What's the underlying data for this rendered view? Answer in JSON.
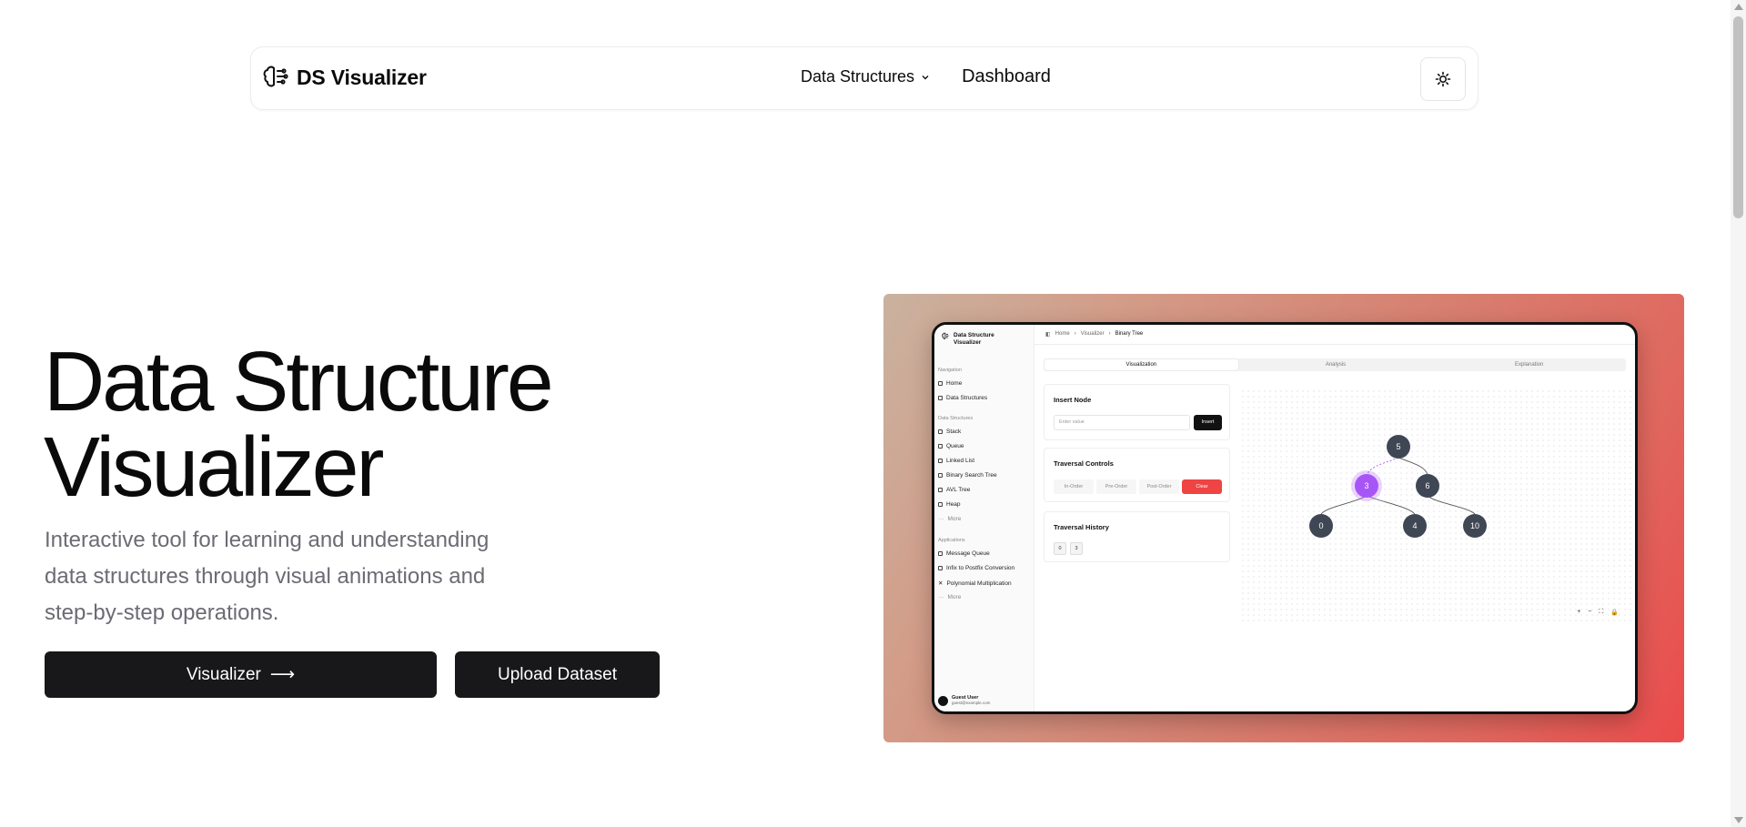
{
  "navbar": {
    "brand": "DS Visualizer",
    "nav_dropdown": "Data Structures",
    "nav_link": "Dashboard"
  },
  "hero": {
    "title_line1": "Data Structure",
    "title_line2": "Visualizer",
    "subtitle": "Interactive tool for learning and understanding data structures through visual animations and step-by-step operations.",
    "primary_button": "Visualizer",
    "primary_arrow": "⟶",
    "secondary_button": "Upload Dataset"
  },
  "preview": {
    "app_title": "Data Structure Visualizer",
    "sidebar": {
      "nav_section": "Navigation",
      "nav_items": [
        "Home",
        "Data Structures"
      ],
      "ds_section": "Data Structures",
      "ds_items": [
        "Stack",
        "Queue",
        "Linked List",
        "Binary Search Tree",
        "AVL Tree",
        "Heap",
        "More"
      ],
      "apps_section": "Applications",
      "apps_items": [
        "Message Queue",
        "Infix to Postfix Conversion",
        "Polynomial Multiplication",
        "More"
      ],
      "user_name": "Guest User",
      "user_email": "guest@example.com"
    },
    "breadcrumb": [
      "Home",
      "Visualizer",
      "Binary Tree"
    ],
    "tabs": [
      "Visualization",
      "Analysis",
      "Explanation"
    ],
    "insert_card": {
      "title": "Insert Node",
      "placeholder": "Enter value",
      "button": "Insert"
    },
    "traversal_card": {
      "title": "Traversal Controls",
      "buttons": [
        "In-Order",
        "Pre-Order",
        "Post-Order"
      ],
      "clear": "Clear"
    },
    "history_card": {
      "title": "Traversal History",
      "values": [
        "0",
        "3"
      ]
    },
    "tree_nodes": [
      "5",
      "3",
      "6",
      "0",
      "4",
      "10"
    ],
    "highlight_color": "#a855f7",
    "node_color": "#3f4654",
    "zoom_controls": [
      "+",
      "−",
      "⛶",
      "🔒"
    ]
  },
  "colors": {
    "primary": "#18181b",
    "danger": "#ef4444",
    "muted_text": "#6b6b73"
  }
}
